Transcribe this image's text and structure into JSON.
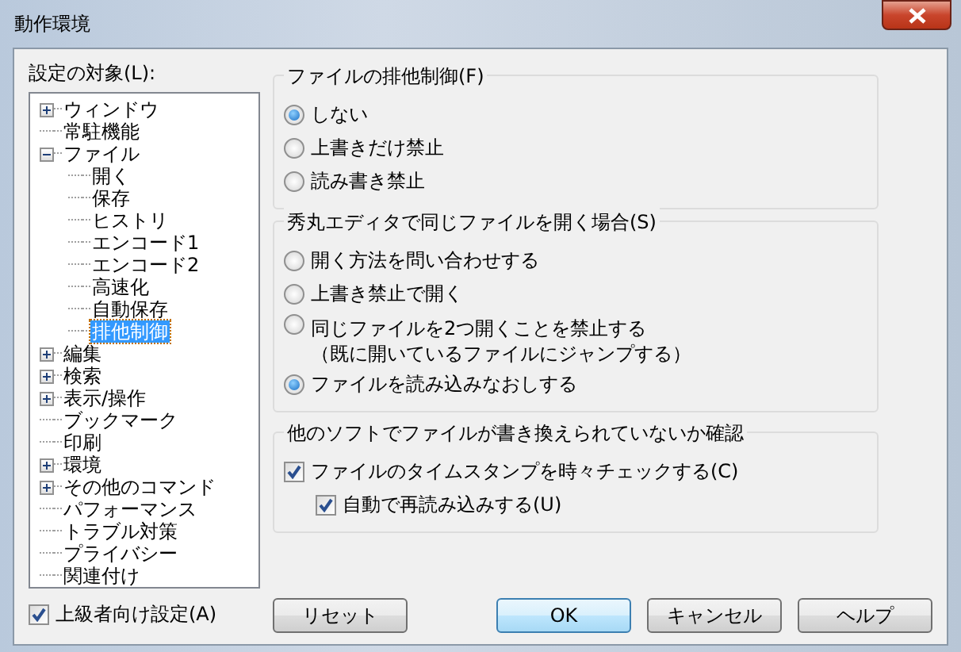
{
  "window": {
    "title": "動作環境"
  },
  "sidebar": {
    "label": "設定の対象(L):",
    "tree": [
      {
        "label": "ウィンドウ",
        "expandable": true,
        "expanded": false,
        "selected": false
      },
      {
        "label": "常駐機能",
        "expandable": false,
        "selected": false
      },
      {
        "label": "ファイル",
        "expandable": true,
        "expanded": true,
        "selected": false,
        "children": [
          {
            "label": "開く",
            "expandable": false,
            "selected": false
          },
          {
            "label": "保存",
            "expandable": false,
            "selected": false
          },
          {
            "label": "ヒストリ",
            "expandable": false,
            "selected": false
          },
          {
            "label": "エンコード1",
            "expandable": false,
            "selected": false
          },
          {
            "label": "エンコード2",
            "expandable": false,
            "selected": false
          },
          {
            "label": "高速化",
            "expandable": false,
            "selected": false
          },
          {
            "label": "自動保存",
            "expandable": false,
            "selected": false
          },
          {
            "label": "排他制御",
            "expandable": false,
            "selected": true
          }
        ]
      },
      {
        "label": "編集",
        "expandable": true,
        "expanded": false,
        "selected": false
      },
      {
        "label": "検索",
        "expandable": true,
        "expanded": false,
        "selected": false
      },
      {
        "label": "表示/操作",
        "expandable": true,
        "expanded": false,
        "selected": false
      },
      {
        "label": "ブックマーク",
        "expandable": false,
        "selected": false
      },
      {
        "label": "印刷",
        "expandable": false,
        "selected": false
      },
      {
        "label": "環境",
        "expandable": true,
        "expanded": false,
        "selected": false
      },
      {
        "label": "その他のコマンド",
        "expandable": true,
        "expanded": false,
        "selected": false
      },
      {
        "label": "パフォーマンス",
        "expandable": false,
        "selected": false
      },
      {
        "label": "トラブル対策",
        "expandable": false,
        "selected": false
      },
      {
        "label": "プライバシー",
        "expandable": false,
        "selected": false
      },
      {
        "label": "関連付け",
        "expandable": false,
        "selected": false
      }
    ],
    "advanced": {
      "label": "上級者向け設定(A)",
      "checked": true
    }
  },
  "groups": [
    {
      "title": "ファイルの排他制御(F)",
      "options": [
        {
          "kind": "radio",
          "label": "しない",
          "selected": true
        },
        {
          "kind": "radio",
          "label": "上書きだけ禁止",
          "selected": false
        },
        {
          "kind": "radio",
          "label": "読み書き禁止",
          "selected": false
        }
      ]
    },
    {
      "title": "秀丸エディタで同じファイルを開く場合(S)",
      "options": [
        {
          "kind": "radio",
          "label": "開く方法を問い合わせする",
          "selected": false
        },
        {
          "kind": "radio",
          "label": "上書き禁止で開く",
          "selected": false
        },
        {
          "kind": "radio",
          "label": "同じファイルを2つ開くことを禁止する",
          "note": "（既に開いているファイルにジャンプする）",
          "selected": false
        },
        {
          "kind": "radio",
          "label": "ファイルを読み込みなおしする",
          "selected": true
        }
      ]
    },
    {
      "title": "他のソフトでファイルが書き換えられていないか確認",
      "options": [
        {
          "kind": "checkbox",
          "label": "ファイルのタイムスタンプを時々チェックする(C)",
          "checked": true,
          "children": [
            {
              "kind": "checkbox",
              "label": "自動で再読み込みする(U)",
              "checked": true
            }
          ]
        }
      ]
    }
  ],
  "buttons": [
    {
      "label": "リセット",
      "default": false
    },
    {
      "label": "OK",
      "default": true
    },
    {
      "label": "キャンセル",
      "default": false
    },
    {
      "label": "ヘルプ",
      "default": false
    }
  ]
}
